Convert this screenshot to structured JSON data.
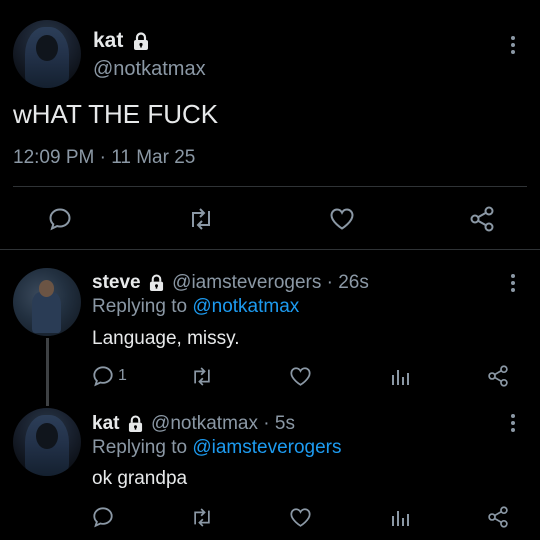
{
  "main_tweet": {
    "display_name": "kat",
    "handle": "@notkatmax",
    "text": "wHAT THE FUCK",
    "timestamp": "12:09 PM · 11 Mar 25",
    "actions": [
      "reply-icon",
      "retweet-icon",
      "like-icon",
      "share-icon"
    ]
  },
  "replies": [
    {
      "display_name": "steve",
      "handle": "@iamsteverogers",
      "time": "· 26s",
      "replying_prefix": "Replying to",
      "replying_to": "@notkatmax",
      "text": "Language, missy.",
      "reply_count": "1"
    },
    {
      "display_name": "kat",
      "handle": "@notkatmax",
      "time": "· 5s",
      "replying_prefix": "Replying to",
      "replying_to": "@iamsteverogers",
      "text": "ok grandpa",
      "reply_count": ""
    }
  ],
  "colors": {
    "background": "#000000",
    "text": "#e7e9ea",
    "muted": "#8b98a5",
    "link": "#1d9bf0",
    "divider": "#2f3336"
  }
}
